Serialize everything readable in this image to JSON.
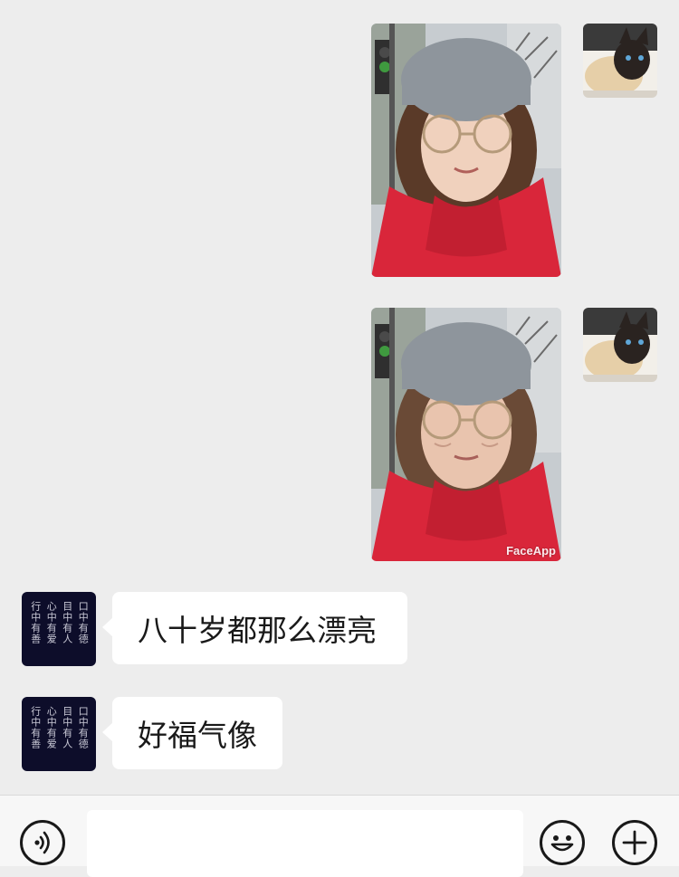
{
  "messages": [
    {
      "type": "image",
      "side": "right",
      "watermark": ""
    },
    {
      "type": "image",
      "side": "right",
      "watermark": "FaceApp"
    },
    {
      "type": "text",
      "side": "left",
      "text": "八十岁都那么漂亮"
    },
    {
      "type": "text",
      "side": "left",
      "text": "好福气像"
    }
  ],
  "avatars": {
    "self": {
      "icon": "siamese-cat-avatar"
    },
    "friend": {
      "icon": "calligraphy-avatar",
      "columns": [
        "口中有德",
        "目中有人",
        "心中有爱",
        "行中有善"
      ]
    }
  },
  "input_bar": {
    "voice_icon": "voice-icon",
    "placeholder": "",
    "emoji_icon": "emoji-icon",
    "plus_icon": "plus-icon"
  },
  "colors": {
    "background": "#ededed",
    "bubble": "#ffffff",
    "scarf": "#d9263a",
    "hat": "#8e959c",
    "friend_avatar_bg": "#0d0d2a"
  }
}
